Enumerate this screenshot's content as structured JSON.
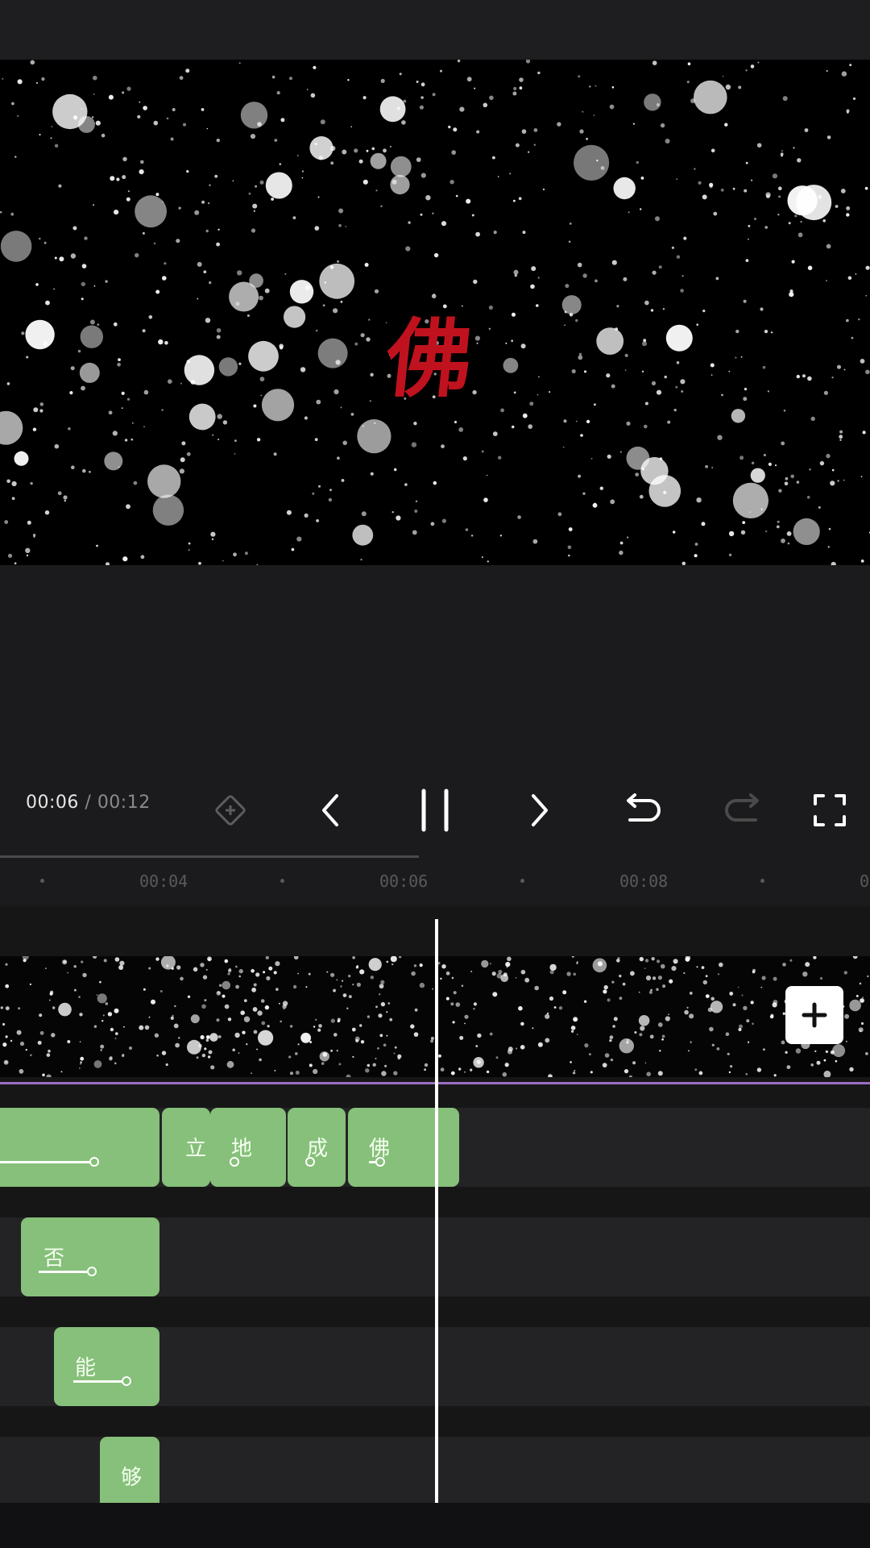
{
  "preview": {
    "title_char": "佛"
  },
  "playback": {
    "current_time": "00:06",
    "separator": " / ",
    "total_time": "00:12"
  },
  "ruler": {
    "labels": [
      "00:04",
      "00:06",
      "00:08",
      "0"
    ]
  },
  "timeline": {
    "lane1_clips": [
      "",
      "立",
      "地",
      "成",
      "佛"
    ],
    "lane2_clip": "否",
    "lane3_clip": "能",
    "lane4_clip": "够"
  },
  "colors": {
    "accent_clip": "#86c07a",
    "title_red": "#c0121e",
    "track_divider": "#9b6fc2"
  },
  "icons": [
    "keyframe-icon",
    "prev-frame-icon",
    "pause-icon",
    "next-frame-icon",
    "undo-icon",
    "redo-icon",
    "fullscreen-icon",
    "add-icon"
  ]
}
